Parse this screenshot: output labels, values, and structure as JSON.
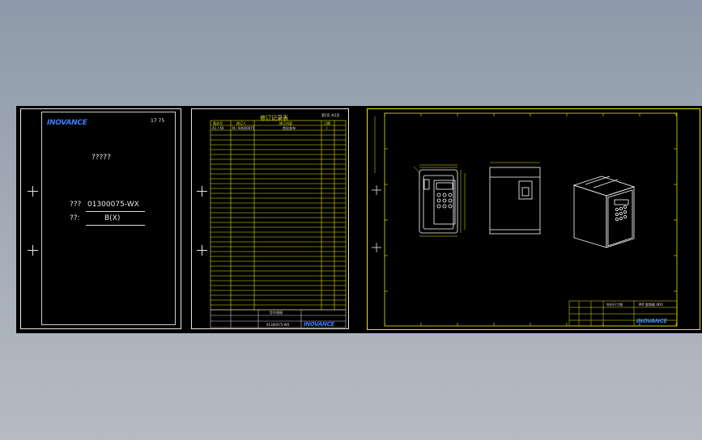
{
  "cover": {
    "brand": "INOVANCE",
    "page_marks": "17  75",
    "title": "?????",
    "code_label": "???",
    "code_value": "01300075-WX",
    "version_label": "??:",
    "version_value": "B(X)"
  },
  "revision": {
    "heading": "修订记录表",
    "page_mark": "第2页 共2页",
    "headers": [
      "版本号",
      "修订人",
      "修订内容",
      "日期"
    ],
    "first_row": [
      "A1 / A0",
      "N / 00000075",
      "首次发布",
      "/"
    ],
    "footer_label": "型号规格",
    "footer_code": "01300075-WX",
    "footer_brand": "INOVANCE"
  },
  "drawing": {
    "brand": "INOVANCE",
    "title_label": "外形尺寸图",
    "product_label": "MD 变频器 (BX)"
  },
  "colors": {
    "background": "#000000",
    "frame": "#e8e8e8",
    "yellow": "#e6e60a",
    "brand": "#3d7dff"
  }
}
